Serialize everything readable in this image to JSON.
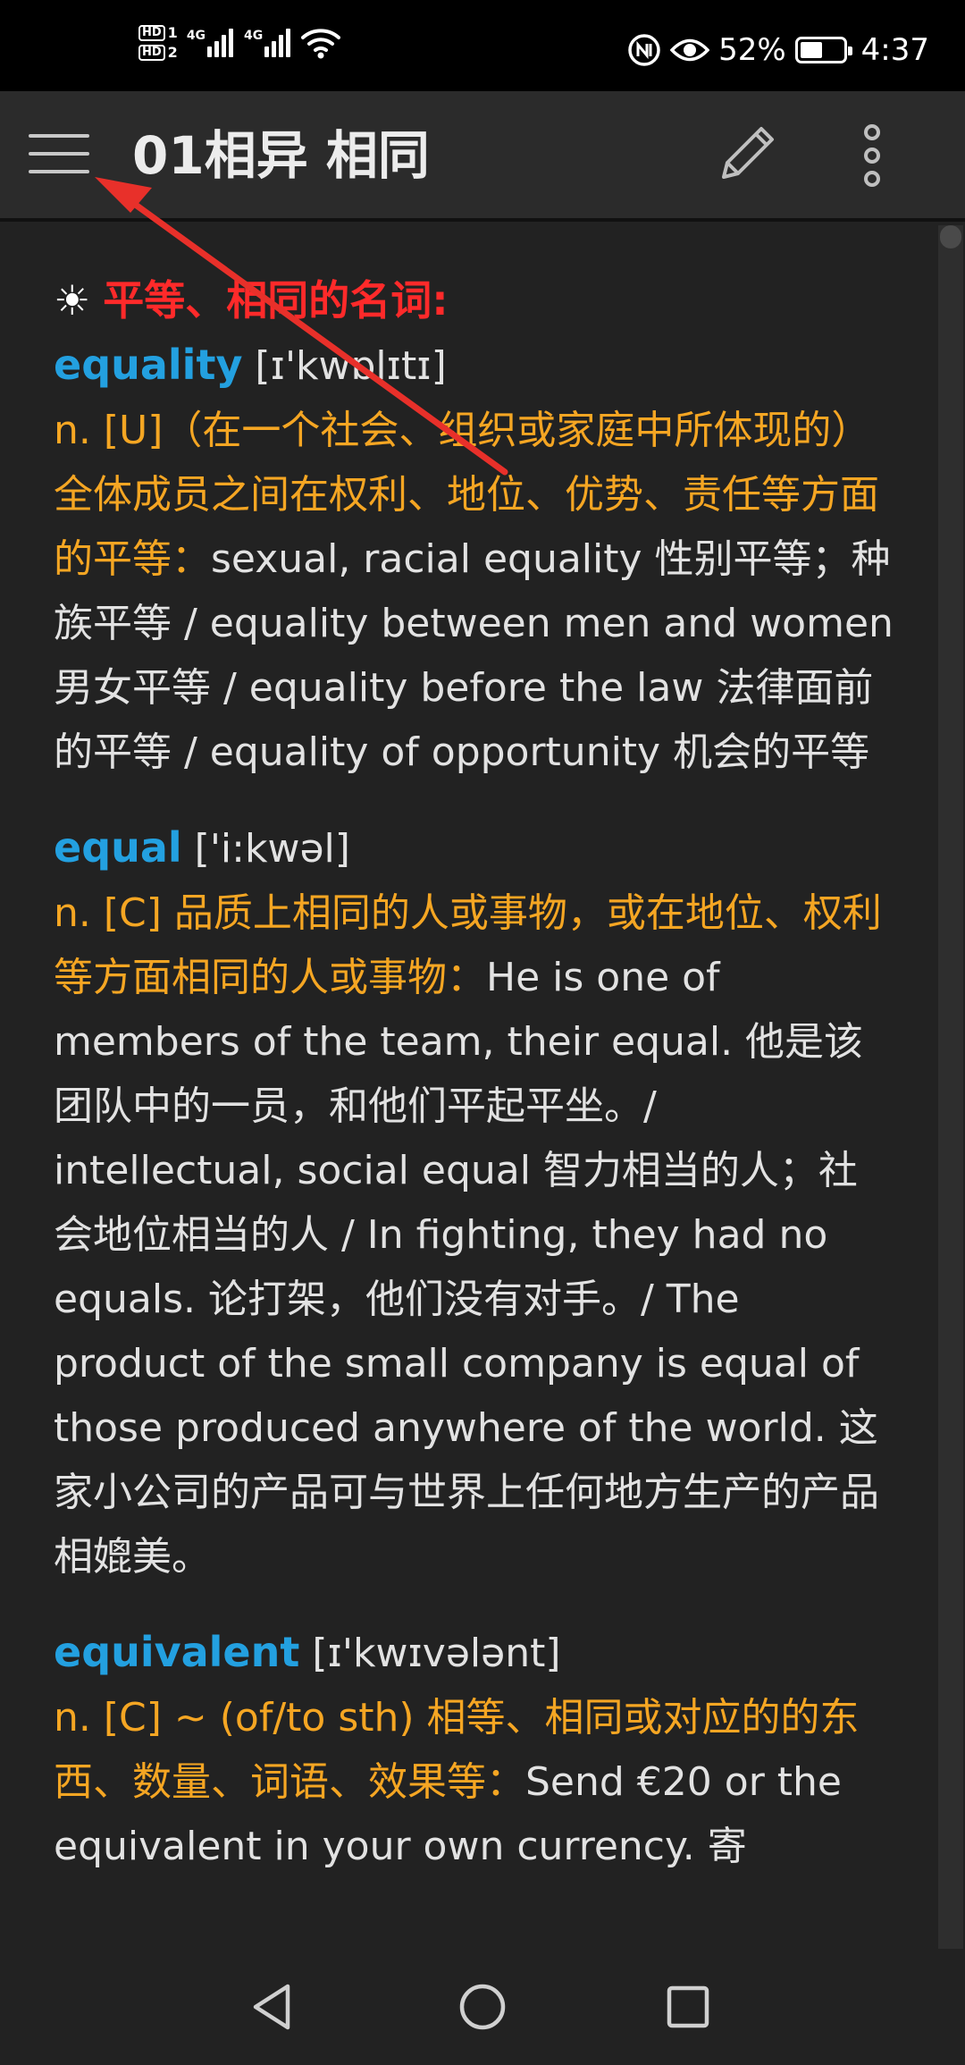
{
  "status_bar": {
    "sim1_label": "HD",
    "sim1_num": "1",
    "sim2_label": "HD",
    "sim2_num": "2",
    "net1": "4G",
    "net2": "4G",
    "battery_percent": "52%",
    "battery_level": 0.52,
    "time": "4:37"
  },
  "toolbar": {
    "title": "01相异 相同",
    "icons": [
      "menu-icon",
      "pencil-icon",
      "more-vert-icon"
    ]
  },
  "section": {
    "symbol": "☀",
    "heading": "平等、相同的名词:"
  },
  "entries": [
    {
      "word": "equality",
      "ipa": " [ɪ'kwɒlɪtɪ]",
      "definition": "n. [U]（在一个社会、组织或家庭中所体现的）全体成员之间在权利、地位、优势、责任等方面的平等：",
      "examples": "sexual, racial equality 性别平等；种族平等 / equality between men and women 男女平等 / equality before the law 法律面前的平等 / equality of opportunity 机会的平等"
    },
    {
      "word": "equal",
      "ipa": " ['i:kwəl]",
      "definition": "n. [C] 品质上相同的人或事物，或在地位、权利等方面相同的人或事物：",
      "examples": "He is one of members of the team, their equal. 他是该团队中的一员，和他们平起平坐。/ intellectual, social equal 智力相当的人；社会地位相当的人 / In fighting, they had no equals. 论打架，他们没有对手。/ The product of the small company is equal of those produced anywhere of the world. 这家小公司的产品可与世界上任何地方生产的产品相媲美。"
    },
    {
      "word": "equivalent",
      "ipa": " [ɪ'kwɪvələnt]",
      "definition": "n. [C] ~ (of/to sth) 相等、相同或对应的的东西、数量、词语、效果等：",
      "examples": "Send €20 or the equivalent in your own currency. 寄"
    }
  ],
  "nav_bar": {
    "icons": [
      "back-triangle-icon",
      "home-circle-icon",
      "recents-square-icon"
    ]
  },
  "colors": {
    "background": "#222222",
    "toolbar": "#2b2b2b",
    "heading_red": "#ff2a2a",
    "word_blue": "#23a0e0",
    "definition_orange": "#f5a623",
    "text": "#e2e2e2",
    "annotation_arrow": "#e8302a"
  }
}
